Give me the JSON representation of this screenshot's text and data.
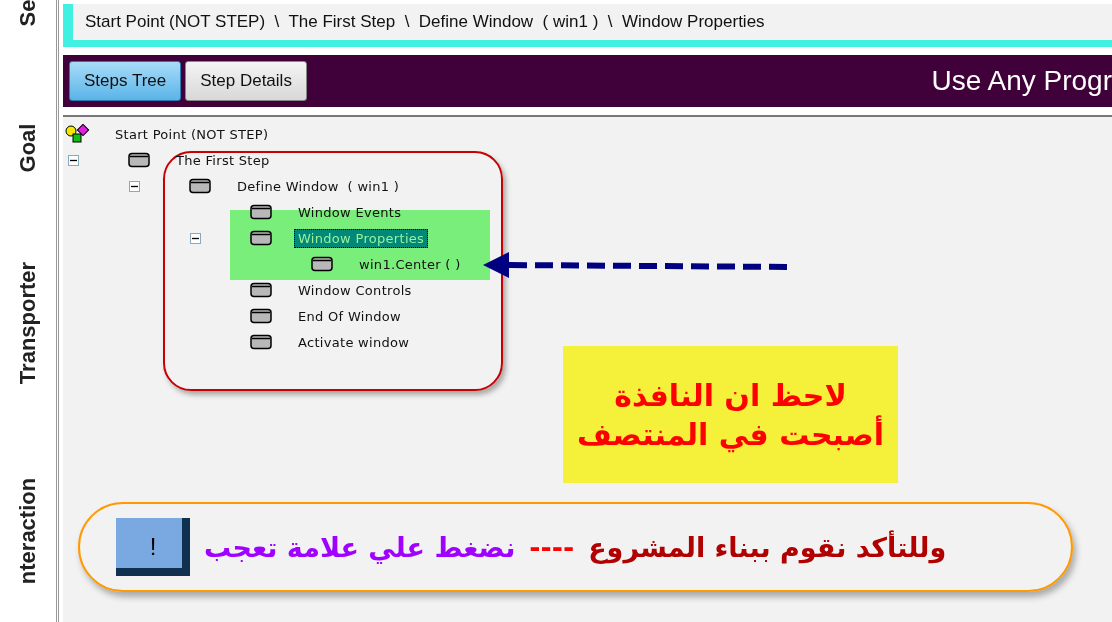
{
  "side_tabs": [
    {
      "label": "Se"
    },
    {
      "label": "Goal"
    },
    {
      "label": "Transporter"
    },
    {
      "label": "nteraction"
    }
  ],
  "breadcrumb": "Start Point (NOT STEP)  \\  The First Step  \\  Define Window  ( win1 )  \\  Window Properties",
  "tabs": [
    {
      "label": "Steps Tree",
      "selected": true
    },
    {
      "label": "Step Details",
      "selected": false
    }
  ],
  "header_title": "Use Any Progr",
  "tree": [
    {
      "label": "Start Point (NOT STEP)",
      "kind": "start",
      "selected": false,
      "children": [
        {
          "label": "The First Step",
          "kind": "step",
          "selected": false,
          "expanded": true,
          "children": [
            {
              "label": "Define Window  ( win1 )",
              "kind": "step",
              "selected": false,
              "expanded": true,
              "children": [
                {
                  "label": "Window Events",
                  "kind": "step",
                  "selected": false
                },
                {
                  "label": "Window Properties",
                  "kind": "step",
                  "selected": true,
                  "expanded": true,
                  "children": [
                    {
                      "label": "win1.Center ( )",
                      "kind": "step",
                      "selected": false
                    }
                  ]
                },
                {
                  "label": "Window Controls",
                  "kind": "step",
                  "selected": false
                },
                {
                  "label": "End Of Window",
                  "kind": "step",
                  "selected": false
                },
                {
                  "label": "Activate window",
                  "kind": "step",
                  "selected": false
                }
              ]
            }
          ]
        }
      ]
    }
  ],
  "note": [
    "لاحظ ان النافذة",
    "أصبحت في المنتصف"
  ],
  "callout": {
    "button": "!",
    "parts": [
      {
        "text": "وللتأكد نقوم ببناء المشروع",
        "color": "#b00000"
      },
      {
        "text": "----",
        "color": "#ff0000"
      },
      {
        "text": "نضغط علي علامة تعجب",
        "color": "#a000ff"
      }
    ]
  }
}
